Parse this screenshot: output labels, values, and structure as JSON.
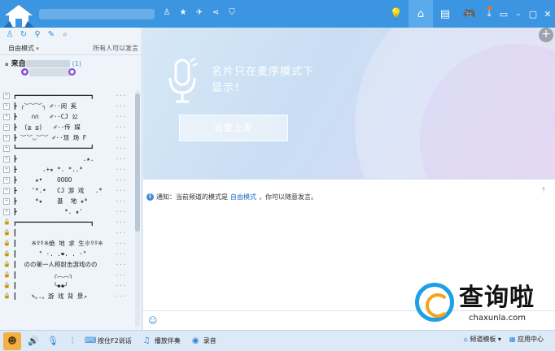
{
  "titlebar": {
    "right_buttons": [
      {
        "name": "bulb-icon",
        "glyph": "💡"
      },
      {
        "name": "home-icon",
        "glyph": "⌂"
      },
      {
        "name": "list-icon",
        "glyph": "▤"
      },
      {
        "name": "gamepad-icon",
        "glyph": "🎮"
      }
    ],
    "window_buttons": [
      "⤓",
      "▭",
      "–",
      "▢",
      "✕"
    ]
  },
  "left": {
    "mode_label": "自由模式",
    "mode_note": "所有人可以发言",
    "channel_prefix": "来自",
    "channel_count": "(1)",
    "rows": [
      {
        "t": "┏━━━━━━━━━━━━━━━━━━━━┓",
        "lock": false
      },
      {
        "t": "┣ ╭︶︶︶╮ ✐··闵 奚",
        "lock": false
      },
      {
        "t": "┣    ∩∩   ✐··CJ 公",
        "lock": false
      },
      {
        "t": "┣  (≧ ≦)   ✐··传 媒",
        "lock": false
      },
      {
        "t": "┣ ︶︶◡︶︶ ✐··现 场 F",
        "lock": false
      },
      {
        "t": "┗━━━━━━━━━━━━━━━━━━━━┛",
        "lock": false
      },
      {
        "t": "┣                  .★.",
        "lock": false
      },
      {
        "t": "┣       .+★ *. *..*",
        "lock": false
      },
      {
        "t": "┣     ★•    OOOO",
        "lock": false
      },
      {
        "t": "┣    '*.•   CJ 游 戏   .*",
        "lock": false
      },
      {
        "t": "┣     *★    基  地 ★*",
        "lock": false
      },
      {
        "t": "┣             *. ★'",
        "lock": false
      },
      {
        "t": "┏━━━━━━━━━━━━━━━━━━━━┓",
        "lock": true
      },
      {
        "t": "┃",
        "lock": true
      },
      {
        "t": "┃    ※ºº※绝 地 求 生※ºº※",
        "lock": true
      },
      {
        "t": "┃      ° ·. .❤. . ·°",
        "lock": true
      },
      {
        "t": "┃  のの第一人称射击游戏のの",
        "lock": true
      },
      {
        "t": "┃          ╭︵︵╮",
        "lock": true
      },
      {
        "t": "┃          ╰◆◆╯",
        "lock": true
      },
      {
        "t": "┃    ✎｡.。游 戏 背 景↗",
        "lock": true
      }
    ]
  },
  "stage": {
    "message": "名片只在麦序模式下显示！",
    "mic_button": "我要上麦"
  },
  "chat": {
    "notice_prefix": "通知：当前频道的模式是",
    "notice_mode": "自由模式",
    "notice_suffix": "，你可以随意发言。"
  },
  "bottom": {
    "items": [
      {
        "name": "speaker-icon",
        "glyph": "🔊"
      },
      {
        "name": "microphone-icon",
        "glyph": "🎙"
      },
      {
        "name": "equalizer-icon",
        "glyph": "⫶"
      }
    ],
    "ptt_label": "按住F2说话",
    "music_label": "播放伴奏",
    "record_label": "录音",
    "template_label": "频道模板",
    "app_center_label": "应用中心"
  },
  "watermark": {
    "text": "查询啦",
    "url": "chaxunla.com"
  }
}
